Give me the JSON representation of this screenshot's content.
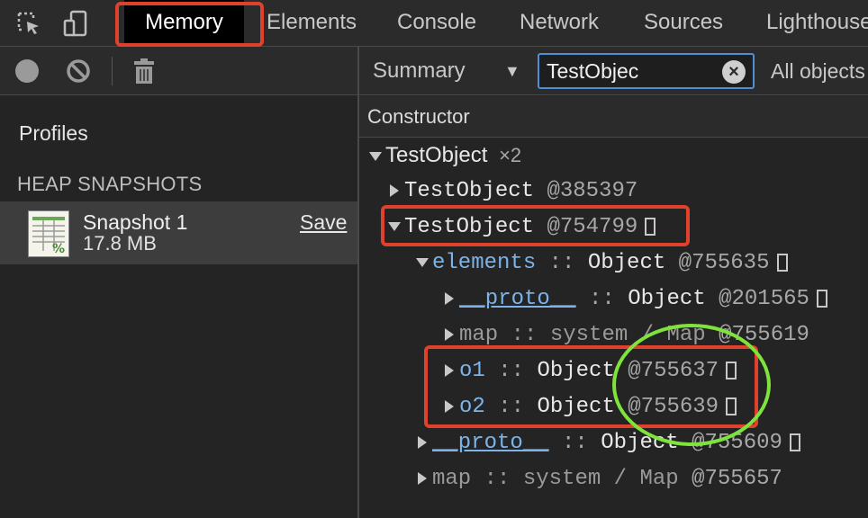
{
  "tabbar": {
    "tabs": [
      "Memory",
      "Elements",
      "Console",
      "Network",
      "Sources",
      "Lighthouse"
    ],
    "active": "Memory",
    "icons": [
      "inspect-element-icon",
      "device-toolbar-icon"
    ]
  },
  "toolbar": {
    "view_label": "Summary",
    "filter_value": "TestObjec",
    "objects_label": "All objects",
    "icons": [
      "record-icon",
      "clear-icon",
      "trash-icon"
    ]
  },
  "sidebar": {
    "title": "Profiles",
    "section": "HEAP SNAPSHOTS",
    "snapshot": {
      "name": "Snapshot 1",
      "size": "17.8 MB",
      "save_label": "Save"
    }
  },
  "grid": {
    "header": "Constructor",
    "rows": [
      {
        "name": "TestObject",
        "suffix": "×2"
      },
      {
        "name": "TestObject",
        "id": "@385397"
      },
      {
        "name": "TestObject",
        "id": "@754799"
      },
      {
        "prop": "elements",
        "sep": "::",
        "type": "Object",
        "id": "@755635"
      },
      {
        "prop": "__proto__",
        "sep": "::",
        "type": "Object",
        "id": "@201565"
      },
      {
        "prop": "map",
        "sep": "::",
        "type": "system / Map",
        "id": "@755619"
      },
      {
        "prop": "o1",
        "sep": "::",
        "type": "Object",
        "id": "@755637"
      },
      {
        "prop": "o2",
        "sep": "::",
        "type": "Object",
        "id": "@755639"
      },
      {
        "prop": "__proto__",
        "sep": "::",
        "type": "Object",
        "id": "@755609"
      },
      {
        "prop": "map",
        "sep": "::",
        "type": "system / Map",
        "id": "@755657"
      }
    ]
  },
  "colors": {
    "annotation_red": "#e0412c",
    "annotation_green": "#7ee33b",
    "filter_focus": "#4f8fd6"
  }
}
